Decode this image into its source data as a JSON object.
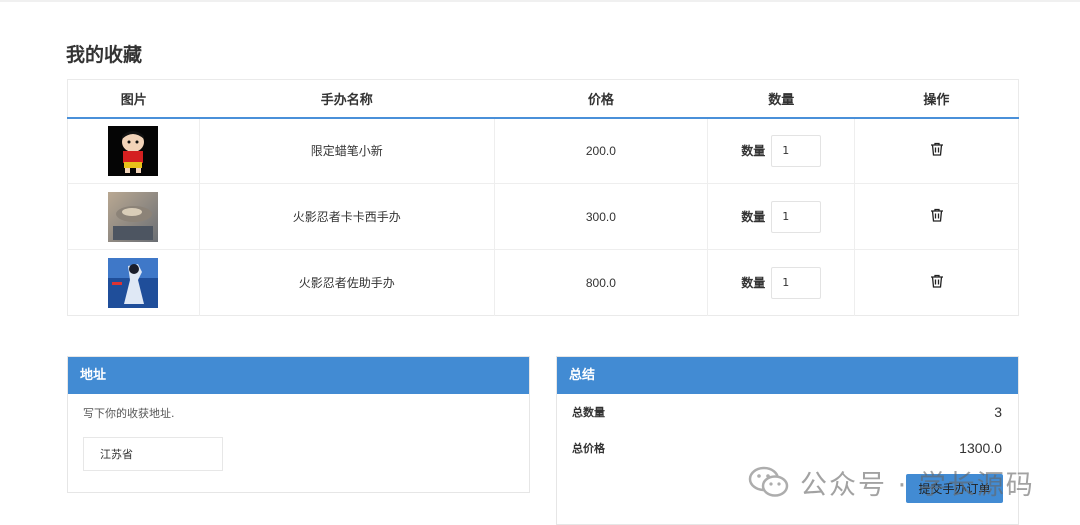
{
  "page": {
    "title": "我的收藏"
  },
  "table": {
    "headers": [
      "图片",
      "手办名称",
      "价格",
      "数量",
      "操作"
    ],
    "rows": [
      {
        "name": "限定蜡笔小新",
        "price": "200.0",
        "qty_label": "数量",
        "qty": "1",
        "image": "crayon-shin-chan-figure"
      },
      {
        "name": "火影忍者卡卡西手办",
        "price": "300.0",
        "qty_label": "数量",
        "qty": "1",
        "image": "kakashi-figure"
      },
      {
        "name": "火影忍者佐助手办",
        "price": "800.0",
        "qty_label": "数量",
        "qty": "1",
        "image": "sasuke-figure"
      }
    ],
    "delete_icon": "trash-icon"
  },
  "address": {
    "title": "地址",
    "hint": "写下你的收获地址.",
    "value": "江苏省"
  },
  "summary": {
    "title": "总结",
    "total_qty_label": "总数量",
    "total_qty": "3",
    "total_price_label": "总价格",
    "total_price": "1300.0",
    "submit_label": "提交手办订单"
  },
  "watermark": {
    "text": "公众号 · 学长源码",
    "icon": "wechat-icon"
  },
  "colors": {
    "accent": "#428bd3"
  }
}
